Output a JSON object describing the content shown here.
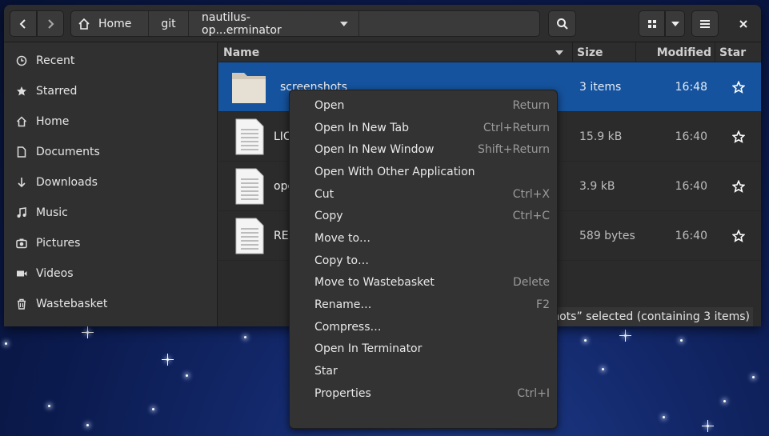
{
  "headerbar": {
    "breadcrumbs": [
      {
        "label": "Home",
        "icon": "home-icon"
      },
      {
        "label": "git"
      },
      {
        "label": "nautilus-op...erminator"
      }
    ]
  },
  "sidebar": {
    "items": [
      {
        "label": "Recent",
        "icon": "clock-icon"
      },
      {
        "label": "Starred",
        "icon": "star-icon"
      },
      {
        "label": "Home",
        "icon": "home-icon"
      },
      {
        "label": "Documents",
        "icon": "document-icon"
      },
      {
        "label": "Downloads",
        "icon": "download-icon"
      },
      {
        "label": "Music",
        "icon": "music-icon"
      },
      {
        "label": "Pictures",
        "icon": "camera-icon"
      },
      {
        "label": "Videos",
        "icon": "video-icon"
      },
      {
        "label": "Wastebasket",
        "icon": "trash-icon"
      }
    ]
  },
  "columns": {
    "name": "Name",
    "size": "Size",
    "modified": "Modified",
    "star": "Star"
  },
  "files": [
    {
      "name": "screenshots",
      "size": "3 items",
      "modified": "16:48",
      "type": "folder",
      "selected": true
    },
    {
      "name": "LIC",
      "size": "15.9 kB",
      "modified": "16:40",
      "type": "text"
    },
    {
      "name": "ope",
      "size": "3.9 kB",
      "modified": "16:40",
      "type": "text"
    },
    {
      "name": "REA",
      "size": "589 bytes",
      "modified": "16:40",
      "type": "text"
    }
  ],
  "status": "nshots” selected  (containing 3 items)",
  "context_menu": [
    {
      "label": "Open",
      "accel": "Return"
    },
    {
      "label": "Open In New Tab",
      "accel": "Ctrl+Return"
    },
    {
      "label": "Open In New Window",
      "accel": "Shift+Return"
    },
    {
      "label": "Open With Other Application",
      "accel": ""
    },
    {
      "label": "Cut",
      "accel": "Ctrl+X"
    },
    {
      "label": "Copy",
      "accel": "Ctrl+C"
    },
    {
      "label": "Move to…",
      "accel": ""
    },
    {
      "label": "Copy to…",
      "accel": ""
    },
    {
      "label": "Move to Wastebasket",
      "accel": "Delete"
    },
    {
      "label": "Rename…",
      "accel": "F2"
    },
    {
      "label": "Compress…",
      "accel": ""
    },
    {
      "label": "Open In Terminator",
      "accel": ""
    },
    {
      "label": "Star",
      "accel": ""
    },
    {
      "label": "Properties",
      "accel": "Ctrl+I"
    }
  ],
  "colors": {
    "accent": "#15539e",
    "window_bg": "#2b2b2b",
    "sidebar_bg": "#303030",
    "menu_bg": "#333333"
  }
}
